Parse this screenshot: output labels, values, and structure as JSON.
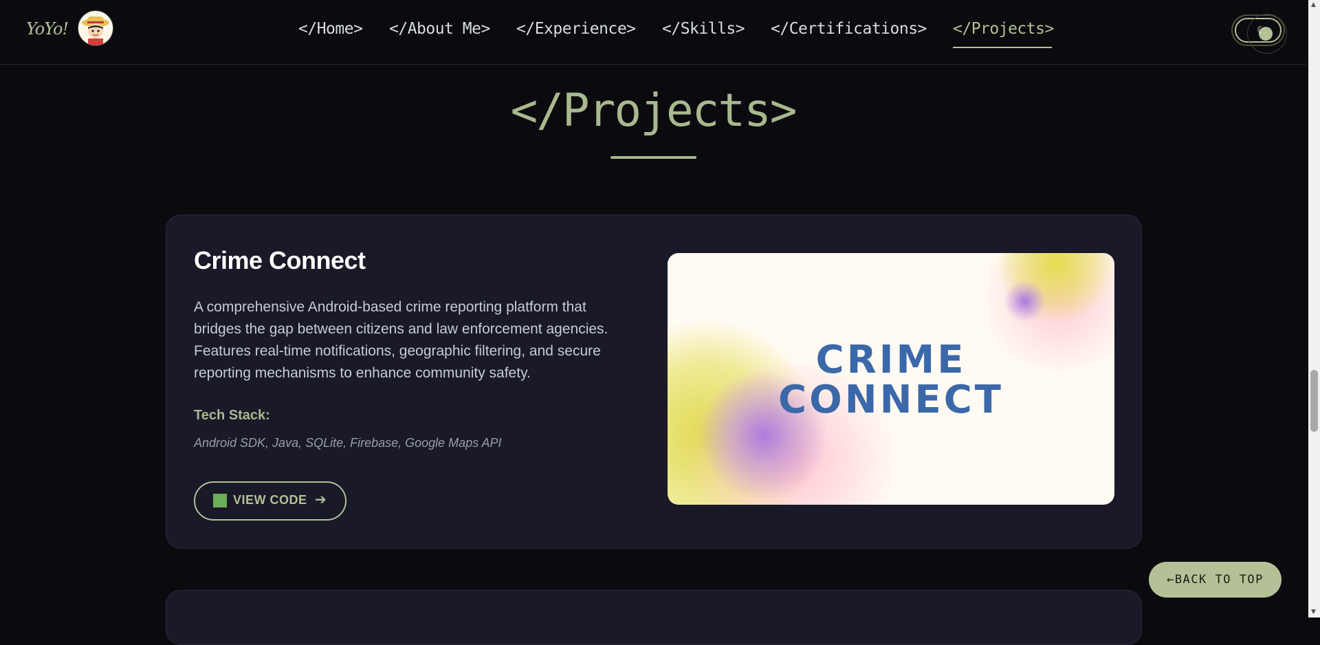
{
  "brand": {
    "logo_text": "YoYo!"
  },
  "nav": {
    "items": [
      {
        "label": "</Home>",
        "active": false
      },
      {
        "label": "</About Me>",
        "active": false
      },
      {
        "label": "</Experience>",
        "active": false
      },
      {
        "label": "</Skills>",
        "active": false
      },
      {
        "label": "</Certifications>",
        "active": false
      },
      {
        "label": "</Projects>",
        "active": true
      }
    ]
  },
  "theme_toggle": {
    "icon": "moon-icon"
  },
  "section": {
    "title": "</Projects>"
  },
  "project": {
    "title": "Crime Connect",
    "description": "A comprehensive Android-based crime reporting platform that bridges the gap between citizens and law enforcement agencies. Features real-time notifications, geographic filtering, and secure reporting mechanisms to enhance community safety.",
    "tech_label": "Tech Stack:",
    "tech_list": "Android SDK, Java, SQLite, Firebase, Google Maps API",
    "view_code_label": "VIEW CODE",
    "view_code_arrow": "➔",
    "image_text_line1": "CRIME",
    "image_text_line2": "CONNECT"
  },
  "back_to_top": {
    "label": "←BACK TO TOP"
  },
  "colors": {
    "accent": "#b4c196",
    "background": "#0b0b0f",
    "card": "#191928",
    "image_title": "#3b68a8"
  }
}
